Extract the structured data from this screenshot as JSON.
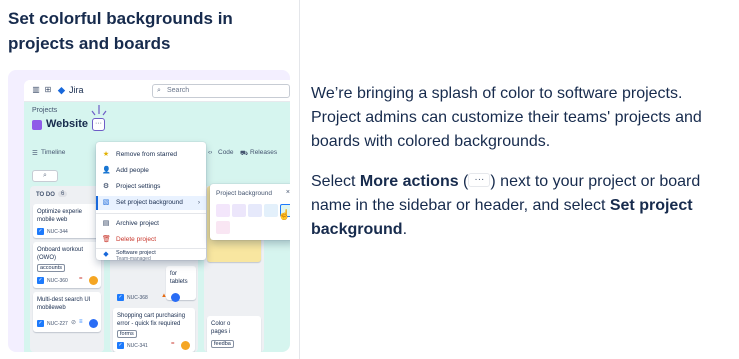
{
  "left": {
    "heading_line1": "Set colorful backgrounds in",
    "heading_line2": "projects and boards"
  },
  "screenshot": {
    "app_name": "Jira",
    "search_placeholder": "Search",
    "breadcrumb": "Projects",
    "project_name": "Website",
    "more_button": "···",
    "tabs": [
      "Timeline",
      "Code",
      "Releases"
    ],
    "board_search_icon": "search-icon",
    "column": {
      "name": "TO DO",
      "count": "6"
    },
    "cards_col1": [
      {
        "title_l1": "Optimize experie",
        "title_l2": "mobile web",
        "key": "NUC-344"
      },
      {
        "title_l1": "Onboard workout",
        "title_l2": "(OWO)",
        "tag": "accounts",
        "key": "NUC-360"
      },
      {
        "title_l1": "Multi-dest search UI",
        "title_l2": "mobileweb",
        "key": "NUC-227"
      }
    ],
    "cards_col2": [
      {
        "title_l1": "Shopping cart purchasing",
        "title_l2": "error - quick fix required",
        "tag": "forms",
        "key": "NUC-341"
      },
      {
        "title_l1": "for tablets",
        "key": "NUC-368"
      }
    ],
    "cards_col3": [
      {
        "title_l1": "Color o",
        "title_l2": "pages i",
        "tag": "feedba"
      }
    ],
    "menu": {
      "items": [
        {
          "label": "Remove from starred",
          "icon": "star-icon"
        },
        {
          "label": "Add people",
          "icon": "person-add-icon"
        },
        {
          "label": "Project settings",
          "icon": "gear-icon"
        },
        {
          "label": "Set project background",
          "icon": "background-icon",
          "selected": true
        },
        {
          "label": "Archive project",
          "icon": "archive-icon"
        },
        {
          "label": "Delete project",
          "icon": "trash-icon"
        }
      ],
      "footer_title": "Software project",
      "footer_sub": "Team-managed"
    },
    "submenu": {
      "title": "Project background",
      "close": "×",
      "swatches": [
        "#f3e6fb",
        "#ece6fb",
        "#e6e9fb",
        "#e3f0fb",
        "#dff5f0",
        "#f9e6f3"
      ]
    }
  },
  "right": {
    "p1": "We’re bringing a splash of color to software projects. Project admins can customize their teams' projects and boards with colored backgrounds.",
    "p2_a": "Select ",
    "p2_bold1": "More actions",
    "p2_b": " (",
    "p2_icon": "···",
    "p2_c": ") next to your project or board name in the sidebar or header, and select ",
    "p2_bold2": "Set project background",
    "p2_d": "."
  },
  "colors": {
    "accent": "#6e5dc6",
    "header_bg": "#d6f5ef",
    "selected_bg": "#e9f2ff",
    "jira_blue": "#1868db"
  }
}
